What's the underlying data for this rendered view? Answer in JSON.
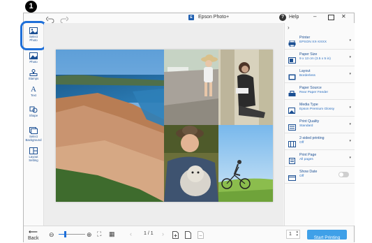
{
  "callout": {
    "number": "1"
  },
  "window": {
    "title": "Epson Photo+",
    "help_label": "Help"
  },
  "tools": [
    {
      "label1": "Select",
      "label2": "Photo",
      "selected": true
    },
    {
      "label1": "Photo",
      "label2": ""
    },
    {
      "label1": "Stamps",
      "label2": ""
    },
    {
      "label1": "Text",
      "label2": ""
    },
    {
      "label1": "Shape",
      "label2": ""
    },
    {
      "label1": "Select",
      "label2": "Background"
    },
    {
      "label1": "Layout",
      "label2": "Setting"
    }
  ],
  "settings": [
    {
      "title": "Printer",
      "value": "EPSON XX-XXXX",
      "icon": "printer-icon"
    },
    {
      "title": "Paper Size",
      "value": "9 x 13 cm (3.5 x 5 in)",
      "icon": "paper-size-icon"
    },
    {
      "title": "Layout",
      "value": "Borderless",
      "icon": "layout-icon"
    },
    {
      "title": "Paper Source",
      "value": "Rear Paper Feeder",
      "icon": "paper-source-icon"
    },
    {
      "title": "Media Type",
      "value": "Epson Premium Glossy",
      "icon": "media-type-icon"
    },
    {
      "title": "Print Quality",
      "value": "Standard",
      "icon": "print-quality-icon"
    },
    {
      "title": "2-sided printing",
      "value": "Off",
      "icon": "two-sided-icon"
    },
    {
      "title": "Print Page",
      "value": "All pages",
      "icon": "print-page-icon"
    },
    {
      "title": "Show Date",
      "value": "Off",
      "icon": "show-date-icon"
    }
  ],
  "bottom": {
    "back_label": "Back",
    "page_indicator": "1 / 1",
    "copies": "1",
    "start_printing": "Start Printing"
  },
  "colors": {
    "accent": "#1e6fd9",
    "start_button": "#3fa0e8",
    "label_blue": "#1b4f93"
  }
}
